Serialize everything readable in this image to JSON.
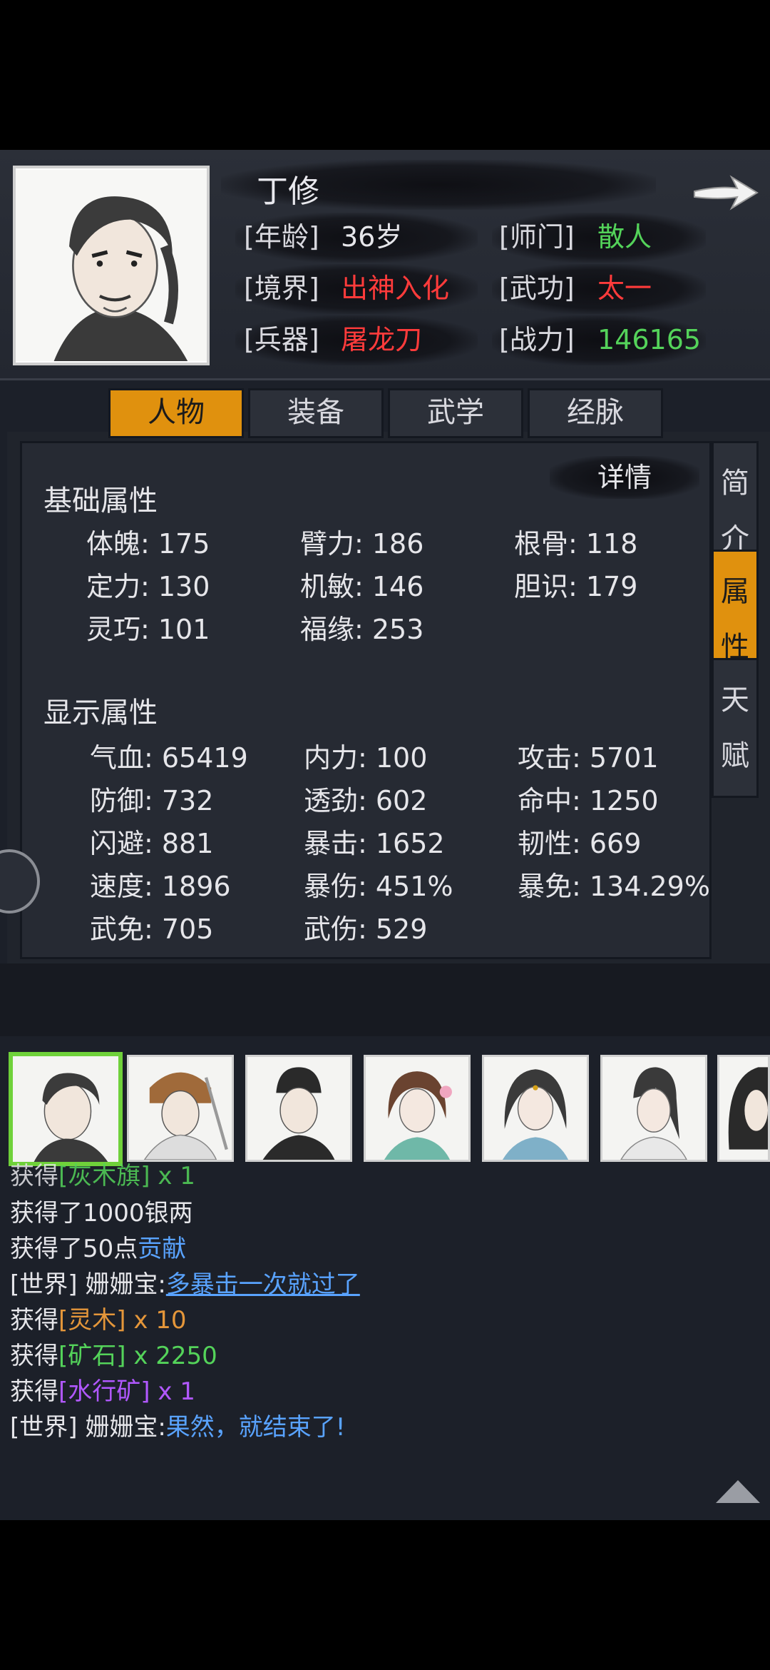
{
  "header": {
    "name": "丁修",
    "age_label": "[年龄]",
    "age": "36岁",
    "sect_label": "[师门]",
    "sect": "散人",
    "realm_label": "[境界]",
    "realm": "出神入化",
    "skill_label": "[武功]",
    "skill": "太一",
    "weapon_label": "[兵器]",
    "weapon": "屠龙刀",
    "power_label": "[战力]",
    "power": "146165"
  },
  "tabs": [
    "人物",
    "装备",
    "武学",
    "经脉"
  ],
  "side_tabs": [
    {
      "c1": "简",
      "c2": "介"
    },
    {
      "c1": "属",
      "c2": "性"
    },
    {
      "c1": "天",
      "c2": "赋"
    }
  ],
  "detail_button": "详情",
  "basic": {
    "title": "基础属性",
    "stats": [
      "体魄: 175",
      "臂力: 186",
      "根骨: 118",
      "定力: 130",
      "机敏: 146",
      "胆识: 179",
      "灵巧: 101",
      "福缘: 253"
    ]
  },
  "display": {
    "title": "显示属性",
    "stats": [
      "气血: 65419",
      "内力: 100",
      "攻击: 5701",
      "防御: 732",
      "透劲: 602",
      "命中: 1250",
      "闪避: 881",
      "暴击: 1652",
      "韧性: 669",
      "速度: 1896",
      "暴伤: 451%",
      "暴免: 134.29%",
      "武免: 705",
      "武伤: 529"
    ]
  },
  "log": {
    "l0": {
      "a": "获得",
      "b": "[灰木旗]",
      "c": " x 1"
    },
    "l1": {
      "a": "获得了1000银两"
    },
    "l2": {
      "a": "获得了50点",
      "b": "贡献"
    },
    "l3": {
      "a": "[世界] 姗姗宝:",
      "b": "多暴击一次就过了"
    },
    "l4": {
      "a": "获得",
      "b": "[灵木]",
      "c": " x 10"
    },
    "l5": {
      "a": "获得",
      "b": "[矿石]",
      "c": " x 2250"
    },
    "l6": {
      "a": "获得",
      "b": "[水行矿]",
      "c": " x 1"
    },
    "l7": {
      "a": "[世界] 姗姗宝:",
      "b": "果然，就结束了!"
    }
  },
  "colors": {
    "accent": "#e0910e",
    "green": "#54d35a",
    "red": "#ff3b3b",
    "blue": "#59a3ff",
    "purple": "#b158ff",
    "orange": "#e4963a"
  }
}
